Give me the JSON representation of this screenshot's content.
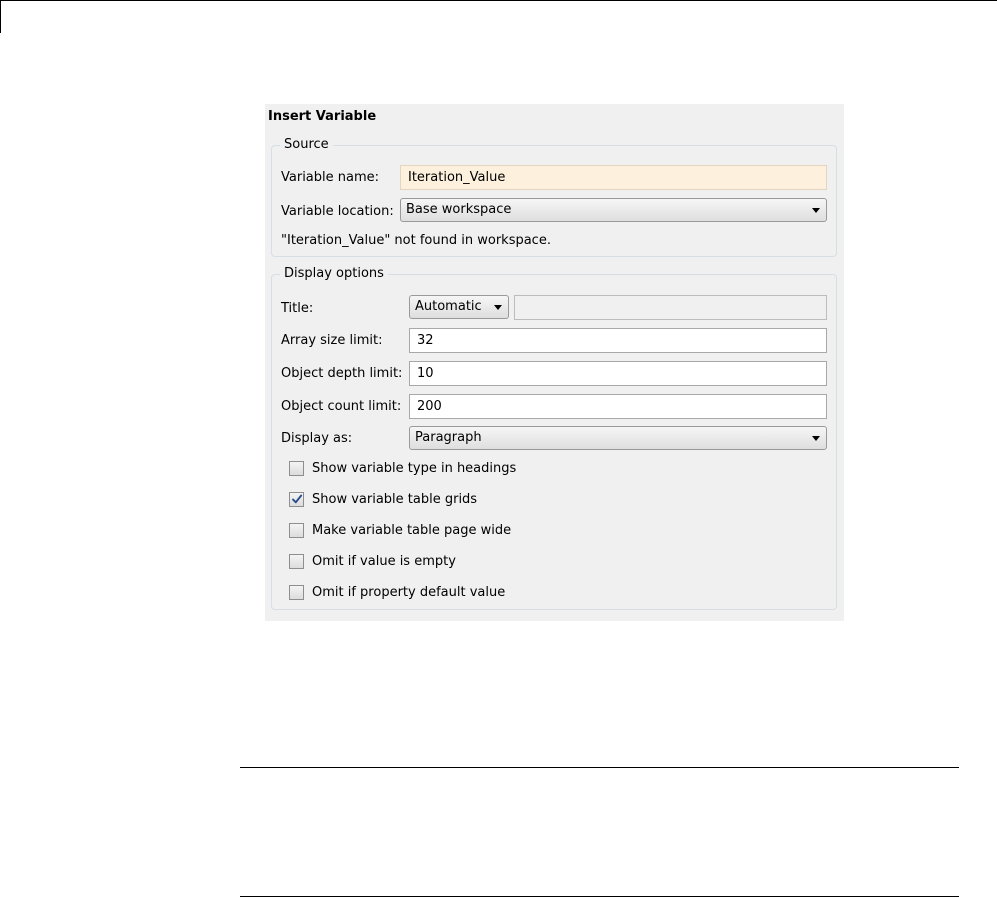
{
  "dialog": {
    "title": "Insert Variable"
  },
  "source": {
    "legend": "Source",
    "variable_name": {
      "label": "Variable name:",
      "value": "Iteration_Value"
    },
    "variable_location": {
      "label": "Variable location:",
      "value": "Base workspace"
    },
    "status_message": "\"Iteration_Value\" not found in workspace."
  },
  "display_options": {
    "legend": "Display options",
    "title": {
      "label": "Title:",
      "mode": "Automatic",
      "custom_value": ""
    },
    "array_size_limit": {
      "label": "Array size limit:",
      "value": "32"
    },
    "object_depth_limit": {
      "label": "Object depth limit:",
      "value": "10"
    },
    "object_count_limit": {
      "label": "Object count limit:",
      "value": "200"
    },
    "display_as": {
      "label": "Display as:",
      "value": "Paragraph"
    },
    "checkboxes": [
      {
        "label": "Show variable type in headings",
        "checked": false
      },
      {
        "label": "Show variable table grids",
        "checked": true
      },
      {
        "label": "Make variable table page wide",
        "checked": false
      },
      {
        "label": "Omit if value is empty",
        "checked": false
      },
      {
        "label": "Omit if property default value",
        "checked": false
      }
    ]
  },
  "colors": {
    "dialog_background": "#f0f0f0",
    "highlighted_field": "#fdf0dc",
    "group_border": "#d5dfe5",
    "check_mark": "#2a4b8d"
  },
  "icons": {
    "dropdown": "chevron-down-icon",
    "checked": "checkmark-icon"
  }
}
